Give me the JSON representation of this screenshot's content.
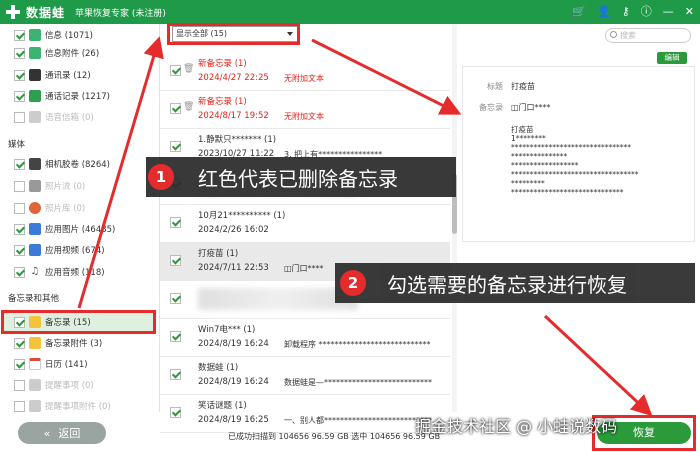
{
  "titlebar": {
    "brand": "数据蛙",
    "title": "苹果恢复专家 (未注册)",
    "icons": [
      "cart-icon",
      "user-icon",
      "key-icon",
      "info-icon",
      "minimize-icon",
      "close-icon"
    ]
  },
  "sidebar": {
    "items": [
      {
        "label": "信息 (1071)",
        "checked": true,
        "icon_color": "#3cb371"
      },
      {
        "label": "信息附件 (26)",
        "checked": true,
        "icon_color": "#3cb371"
      },
      {
        "label": "通讯录 (12)",
        "checked": true,
        "icon_color": "#333333"
      },
      {
        "label": "通话记录 (1217)",
        "checked": true,
        "icon_color": "#2e9e4f"
      },
      {
        "label": "语音信箱 (0)",
        "checked": false,
        "icon_color": "#bbbbbb"
      }
    ],
    "group_media": "媒体",
    "media": [
      {
        "label": "相机胶卷 (8264)",
        "checked": true,
        "icon_color": "#444444"
      },
      {
        "label": "照片流 (0)",
        "checked": false,
        "icon_color": "#bbbbbb"
      },
      {
        "label": "照片库 (0)",
        "checked": false,
        "icon_color": "#e0663a"
      },
      {
        "label": "应用图片 (46435)",
        "checked": true,
        "icon_color": "#3a7bd5"
      },
      {
        "label": "应用视频 (674)",
        "checked": true,
        "icon_color": "#3a7bd5"
      },
      {
        "label": "应用音频 (118)",
        "checked": true,
        "icon_color": "#555555"
      }
    ],
    "group_memo": "备忘录和其他",
    "memo": [
      {
        "label": "备忘录 (15)",
        "checked": true,
        "icon_color": "#f5c33b",
        "selected": true
      },
      {
        "label": "备忘录附件 (3)",
        "checked": true,
        "icon_color": "#f5c33b"
      },
      {
        "label": "日历 (141)",
        "checked": true,
        "icon_color": "#e04a3a"
      },
      {
        "label": "提醒事项 (0)",
        "checked": false,
        "icon_color": "#bbbbbb"
      },
      {
        "label": "提醒事项附件 (0)",
        "checked": false,
        "icon_color": "#bbbbbb"
      }
    ],
    "back_label": "返回"
  },
  "list": {
    "filter": "显示全部 (15)",
    "rows": [
      {
        "title": "新备忘录 (1)",
        "date": "2024/4/27 22:25",
        "note": "无附加文本",
        "deleted": true,
        "checked": true
      },
      {
        "title": "新备忘录 (1)",
        "date": "2024/8/17 19:52",
        "note": "无附加文本",
        "deleted": true,
        "checked": true
      },
      {
        "title": "1.静默只******* (1)",
        "date": "2023/10/27 11:22",
        "note": "3. 把上有****************",
        "deleted": false,
        "checked": true
      },
      {
        "title": "",
        "date": "",
        "note": "",
        "deleted": false,
        "checked": true
      },
      {
        "title": "10月21********** (1)",
        "date": "2024/2/26 16:02",
        "note": "",
        "deleted": false,
        "checked": true
      },
      {
        "title": "打疫苗 (1)",
        "date": "2024/7/11 22:53",
        "note": "◫门口****",
        "deleted": false,
        "checked": true,
        "selected": true
      },
      {
        "title": "",
        "date": "",
        "note": "",
        "deleted": false,
        "checked": true
      },
      {
        "title": "Win7电*** (1)",
        "date": "2024/8/19 16:24",
        "note": "卸载程序 ****************************",
        "deleted": false,
        "checked": true
      },
      {
        "title": "数据蛙 (1)",
        "date": "2024/8/19 16:24",
        "note": "数据蛙是—***************************",
        "deleted": false,
        "checked": true
      },
      {
        "title": "笑话谜题 (1)",
        "date": "2024/8/19 16:25",
        "note": "一、别人都***************************",
        "deleted": false,
        "checked": true
      }
    ]
  },
  "detail": {
    "search_placeholder": "搜索",
    "edit_label": "编辑",
    "title_key": "标题",
    "title_val": "打疫苗",
    "memo_key": "备忘录",
    "memo_val": "◫门口****",
    "body": "打疫苗\n1********\n********************************\n***************\n******************\n**********************************\n*********\n******************************"
  },
  "status": "已成功扫描到 104656 96.59 GB  选中 104656 96.59 GB",
  "restore_label": "恢复",
  "annotations": {
    "callout1_num": "1",
    "callout1_text": "红色代表已删除备忘录",
    "callout2_num": "2",
    "callout2_text": "勾选需要的备忘录进行恢复",
    "watermark": "掘金技术社区 @ 小蛙说数码",
    "color": "#e52b2b"
  }
}
